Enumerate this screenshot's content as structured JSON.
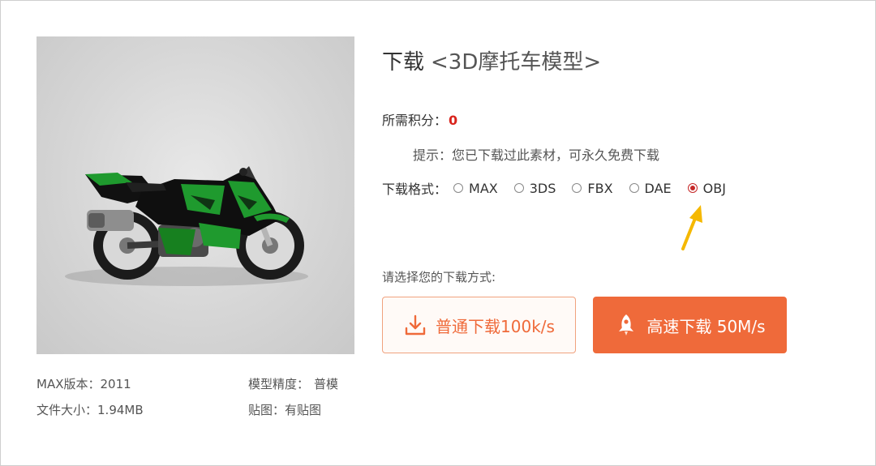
{
  "header": {
    "title_prefix": "下载",
    "model_name": "<3D摩托车模型>"
  },
  "points": {
    "label": "所需积分：",
    "value": "0"
  },
  "hint": "提示：您已下载过此素材，可永久免费下载",
  "format": {
    "label": "下载格式：",
    "options": [
      "MAX",
      "3DS",
      "FBX",
      "DAE",
      "OBJ"
    ],
    "selected": "OBJ"
  },
  "download": {
    "prompt": "请选择您的下载方式:",
    "normal_label": "普通下载100k/s",
    "fast_label": "高速下载 50M/s"
  },
  "meta": {
    "max_version_label": "MAX版本：",
    "max_version": "2011",
    "file_size_label": "文件大小：",
    "file_size": "1.94MB",
    "precision_label": "模型精度：",
    "precision": "普模",
    "texture_label": "贴图：",
    "texture": "有贴图"
  },
  "colors": {
    "accent": "#ef6a3a",
    "points_value": "#d9241c",
    "radio_selected": "#c62828",
    "annotation_arrow": "#f5b800",
    "bike_green": "#1f9a2e"
  },
  "icons": {
    "normal_button": "download-icon",
    "fast_button": "rocket-icon",
    "annotation": "arrow-pointer-icon"
  }
}
